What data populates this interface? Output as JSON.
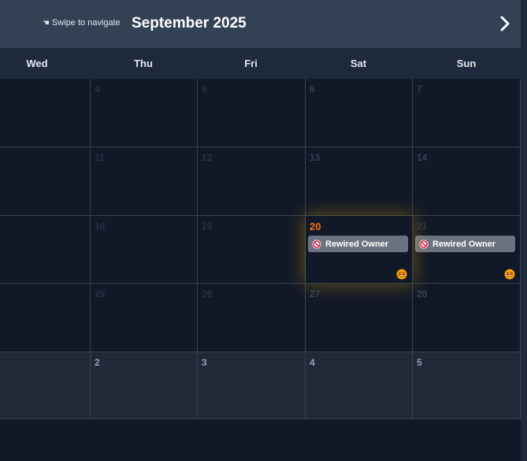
{
  "header": {
    "swipe_icon": "pointing-hand-icon",
    "swipe_hint": "Swipe to navigate",
    "title": "September 2025",
    "next_icon": "chevron-right-icon"
  },
  "weekdays": [
    "Wed",
    "Thu",
    "Fri",
    "Sat",
    "Sun"
  ],
  "weeks": [
    [
      "",
      "4",
      "5",
      "6",
      "7"
    ],
    [
      "",
      "11",
      "12",
      "13",
      "14"
    ],
    [
      "",
      "18",
      "19",
      "20",
      "21"
    ],
    [
      "",
      "25",
      "26",
      "27",
      "28"
    ],
    [
      "",
      "2",
      "3",
      "4",
      "5"
    ]
  ],
  "today": {
    "label": "20",
    "color": "#f97316"
  },
  "events": {
    "sat_20": {
      "label": "Rewired Owner",
      "icon": "ban-icon",
      "badge": "grinning-face-icon"
    },
    "sun_21": {
      "label": "Rewired Owner",
      "icon": "ban-icon",
      "badge": "grinning-face-icon"
    }
  },
  "colors": {
    "background": "#111827",
    "header": "#334155",
    "event": "#6b7280",
    "glow": "#eab308"
  }
}
